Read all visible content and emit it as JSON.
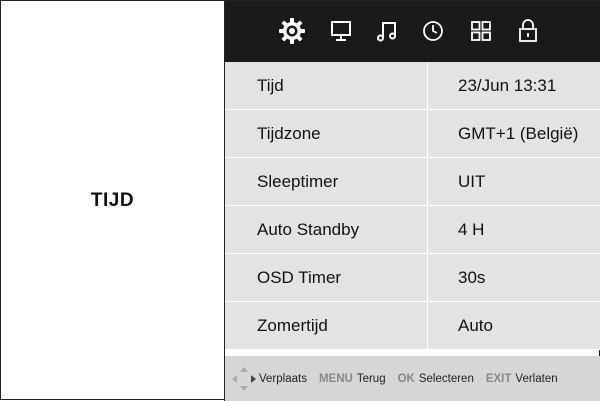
{
  "left_panel": {
    "title": "TIJD"
  },
  "menu_icons": [
    {
      "name": "settings-gear-icon",
      "active": true
    },
    {
      "name": "monitor-icon",
      "active": false
    },
    {
      "name": "music-note-icon",
      "active": false
    },
    {
      "name": "clock-icon",
      "active": false
    },
    {
      "name": "grid-icon",
      "active": false
    },
    {
      "name": "lock-icon",
      "active": false
    }
  ],
  "settings": [
    {
      "label": "Tijd",
      "value": "23/Jun 13:31"
    },
    {
      "label": "Tijdzone",
      "value": "GMT+1 (België)"
    },
    {
      "label": "Sleeptimer",
      "value": "UIT"
    },
    {
      "label": "Auto Standby",
      "value": "4 H"
    },
    {
      "label": "OSD Timer",
      "value": "30s"
    },
    {
      "label": "Zomertijd",
      "value": "Auto"
    }
  ],
  "footer": {
    "move_text": "Verplaats",
    "menu_key": "MENU",
    "menu_text": "Terug",
    "ok_key": "OK",
    "ok_text": "Selecteren",
    "exit_key": "EXIT",
    "exit_text": "Verlaten"
  },
  "colors": {
    "topbar": "#1a1a1a",
    "row_bg": "#e3e3e3",
    "footer_bg": "#d6d6d6",
    "icon": "#ffffff"
  }
}
